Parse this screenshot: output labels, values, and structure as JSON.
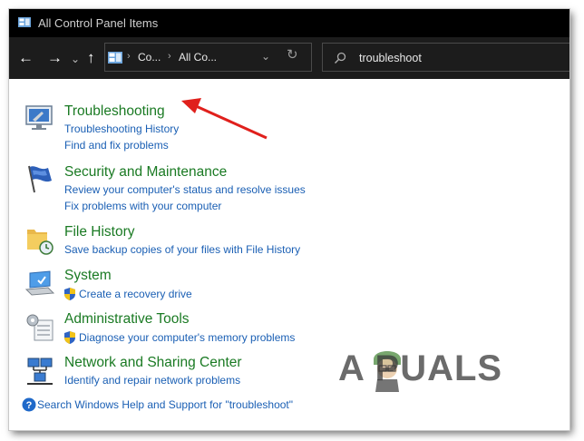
{
  "window": {
    "title": "All Control Panel Items"
  },
  "toolbar": {
    "back": "←",
    "forward": "→",
    "recent": "⌄",
    "up": "↑",
    "crumb_1": "Co...",
    "crumb_2": "All Co...",
    "refresh": "↻",
    "search_value": "troubleshoot"
  },
  "results": [
    {
      "title": "Troubleshooting",
      "links": [
        "Troubleshooting History",
        "Find and fix problems"
      ]
    },
    {
      "title": "Security and Maintenance",
      "links": [
        "Review your computer's status and resolve issues",
        "Fix problems with your computer"
      ]
    },
    {
      "title": "File History",
      "links": [
        "Save backup copies of your files with File History"
      ]
    },
    {
      "title": "System",
      "links": [
        "Create a recovery drive"
      ]
    },
    {
      "title": "Administrative Tools",
      "links": [
        "Diagnose your computer's memory problems"
      ]
    },
    {
      "title": "Network and Sharing Center",
      "links": [
        "Identify and repair network problems"
      ]
    }
  ],
  "help_link": "Search Windows Help and Support for \"troubleshoot\"",
  "watermark": "A  PUALS",
  "colors": {
    "heading": "#1a7a23",
    "link": "#1a5fb4",
    "arrow": "#e0201c",
    "toolbar": "#1c1c1c"
  }
}
